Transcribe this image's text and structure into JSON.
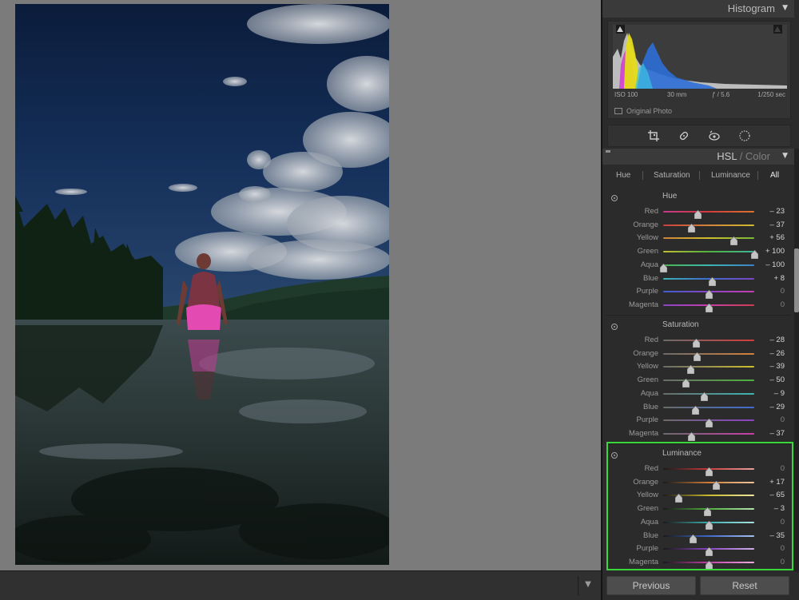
{
  "colors": {
    "canvas_bg": "#7b7b7b",
    "panel_bg": "#2b2b2b",
    "highlight": "#39d739"
  },
  "histogram": {
    "title": "Histogram",
    "iso": "ISO 100",
    "focal": "30 mm",
    "aperture": "ƒ / 5.6",
    "shutter": "1/250 sec",
    "original_photo_label": "Original Photo"
  },
  "tools": [
    "crop-icon",
    "healing-icon",
    "red-eye-icon",
    "mask-icon"
  ],
  "hsl": {
    "title_hsl": "HSL",
    "title_sep": " / ",
    "title_color": "Color",
    "tabs": [
      "Hue",
      "Saturation",
      "Luminance",
      "All"
    ],
    "active_tab": "All",
    "sections": [
      {
        "title": "Hue",
        "rows": [
          {
            "label": "Red",
            "value": -23,
            "display": "– 23"
          },
          {
            "label": "Orange",
            "value": -37,
            "display": "– 37"
          },
          {
            "label": "Yellow",
            "value": 56,
            "display": "+ 56"
          },
          {
            "label": "Green",
            "value": 100,
            "display": "+ 100"
          },
          {
            "label": "Aqua",
            "value": -100,
            "display": "– 100"
          },
          {
            "label": "Blue",
            "value": 8,
            "display": "+ 8"
          },
          {
            "label": "Purple",
            "value": 0,
            "display": "0"
          },
          {
            "label": "Magenta",
            "value": 0,
            "display": "0"
          }
        ]
      },
      {
        "title": "Saturation",
        "rows": [
          {
            "label": "Red",
            "value": -28,
            "display": "– 28"
          },
          {
            "label": "Orange",
            "value": -26,
            "display": "– 26"
          },
          {
            "label": "Yellow",
            "value": -39,
            "display": "– 39"
          },
          {
            "label": "Green",
            "value": -50,
            "display": "– 50"
          },
          {
            "label": "Aqua",
            "value": -9,
            "display": "– 9"
          },
          {
            "label": "Blue",
            "value": -29,
            "display": "– 29"
          },
          {
            "label": "Purple",
            "value": 0,
            "display": "0"
          },
          {
            "label": "Magenta",
            "value": -37,
            "display": "– 37"
          }
        ]
      },
      {
        "title": "Luminance",
        "rows": [
          {
            "label": "Red",
            "value": 0,
            "display": "0"
          },
          {
            "label": "Orange",
            "value": 17,
            "display": "+ 17"
          },
          {
            "label": "Yellow",
            "value": -65,
            "display": "– 65"
          },
          {
            "label": "Green",
            "value": -3,
            "display": "– 3"
          },
          {
            "label": "Aqua",
            "value": 0,
            "display": "0"
          },
          {
            "label": "Blue",
            "value": -35,
            "display": "– 35"
          },
          {
            "label": "Purple",
            "value": 0,
            "display": "0"
          },
          {
            "label": "Magenta",
            "value": 0,
            "display": "0"
          }
        ]
      }
    ]
  },
  "buttons": {
    "previous": "Previous",
    "reset": "Reset"
  }
}
